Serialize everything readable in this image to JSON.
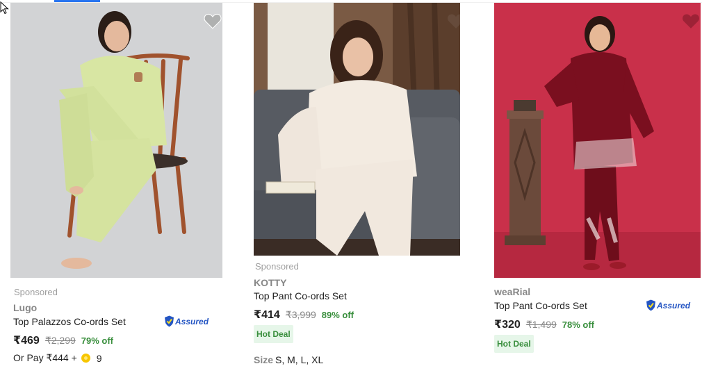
{
  "products": [
    {
      "sponsored": "Sponsored",
      "brand": "Lugo",
      "title": "Top Palazzos Co-ords Set",
      "price": "₹469",
      "mrp": "₹2,299",
      "discount": "79% off",
      "assured": "Assured",
      "pay_later": "Or Pay ₹444 +",
      "coins": "9",
      "wishlisted": false
    },
    {
      "sponsored": "Sponsored",
      "brand": "KOTTY",
      "title": "Top Pant Co-ords Set",
      "price": "₹414",
      "mrp": "₹3,999",
      "discount": "89% off",
      "badge": "Hot Deal",
      "size_label": "Size",
      "sizes": "S, M, L, XL",
      "wishlisted": false
    },
    {
      "brand": "weaRial",
      "title": "Top Pant Co-ords Set",
      "price": "₹320",
      "mrp": "₹1,499",
      "discount": "78% off",
      "assured": "Assured",
      "badge": "Hot Deal",
      "wishlisted": false
    }
  ],
  "colors": {
    "accent": "#2874f0",
    "discount": "#388e3c",
    "hot_deal_bg": "#e6f6e9",
    "assured": "#2455c3"
  }
}
